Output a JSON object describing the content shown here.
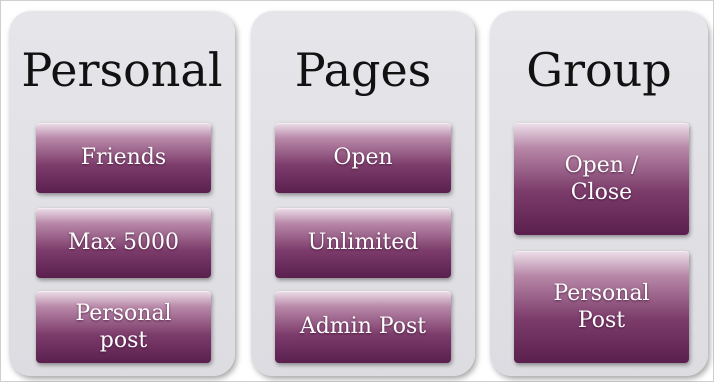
{
  "columns": [
    {
      "title": "Personal",
      "items": [
        "Friends",
        "Max 5000",
        "Personal post"
      ]
    },
    {
      "title": "Pages",
      "items": [
        "Open",
        "Unlimited",
        "Admin Post"
      ]
    },
    {
      "title": "Group",
      "items": [
        "Open / Close",
        "Personal Post"
      ]
    }
  ],
  "colors": {
    "panel": "#e0e0e4",
    "box_dark": "#5a1f4d",
    "box_light": "#ede0ea",
    "title_text": "#111111",
    "box_text": "#ffffff"
  }
}
